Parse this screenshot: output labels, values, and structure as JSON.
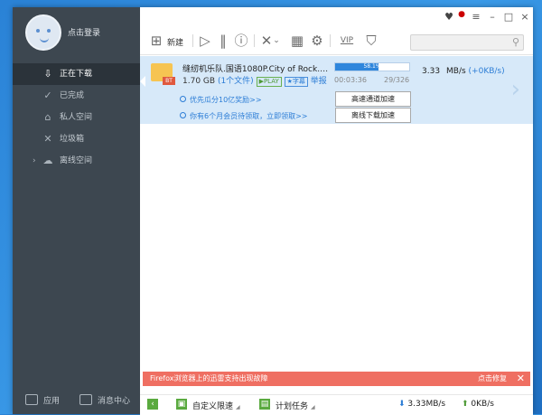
{
  "sidebar": {
    "login": "点击登录",
    "items": [
      {
        "label": "正在下载",
        "icon": "download-icon",
        "glyph": "⇩",
        "active": true
      },
      {
        "label": "已完成",
        "icon": "check-circle-icon",
        "glyph": "✓"
      },
      {
        "label": "私人空间",
        "icon": "lock-icon",
        "glyph": "⌂"
      },
      {
        "label": "垃圾箱",
        "icon": "trash-icon",
        "glyph": "✕"
      },
      {
        "label": "离线空间",
        "icon": "cloud-icon",
        "glyph": "☁"
      }
    ],
    "app_label": "应用",
    "msg_label": "消息中心"
  },
  "toolbar": {
    "new_label": "新建",
    "vip": "VIP"
  },
  "task": {
    "name": "缝纫机乐队.国语1080P.City of Rock.2017...",
    "size": "1.70 GB",
    "file_count": "(1个文件)",
    "play": "▶PLAY",
    "subtitle": "字幕",
    "report": "举报",
    "progress_text": "58.1%",
    "progress": 0.581,
    "elapsed": "00:03:36",
    "pieces": "29/326",
    "speed": "3.33",
    "speed_unit": "MB/s",
    "upload": "(+0KB/s)",
    "promo1": "优先瓜分10亿奖励>>",
    "promo2": "你有6个月会员待领取，立即领取>>",
    "btn_accel": "高速通道加速",
    "btn_offline": "离线下载加速"
  },
  "notice": {
    "text": "Firefox浏览器上的迅雷支持出现故障",
    "fix": "点击修复"
  },
  "status": {
    "custom_speed": "自定义限速",
    "plan_task": "计划任务",
    "down_speed": "3.33MB/s",
    "up_speed": "0KB/s"
  }
}
